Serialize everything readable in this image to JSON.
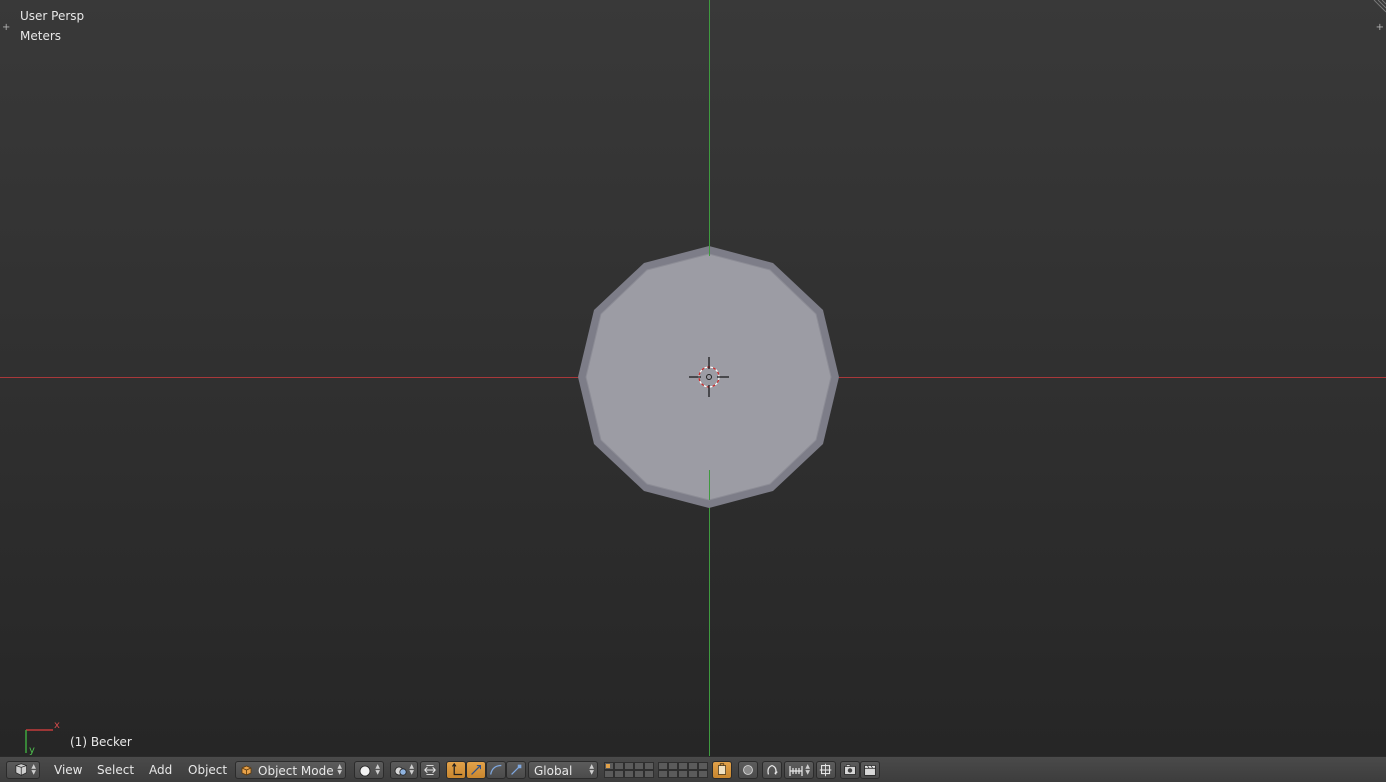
{
  "viewport": {
    "view_name": "User Persp",
    "units": "Meters",
    "object_info": "(1) Becker",
    "axis_x_label": "x",
    "axis_y_label": "y",
    "corner_plus": "+",
    "colors": {
      "x_axis": "#a8383a",
      "y_axis": "#3f9a3f",
      "mesh_face": "#9b9ba3",
      "mesh_edge": "#777781"
    }
  },
  "header": {
    "editor_type_icon": "cube-icon",
    "menus": {
      "view": "View",
      "select": "Select",
      "add": "Add",
      "object": "Object"
    },
    "mode": {
      "label": "Object Mode",
      "icon": "object-cube-icon"
    },
    "shading_icon": "solid-sphere-icon",
    "pivot_icon": "pivot-icon",
    "manipulator_toggle_icon": "manipulator-icon",
    "manipulator_translate_icon": "translate-arrow-icon",
    "manipulator_rotate_icon": "rotate-arc-icon",
    "manipulator_scale_icon": "scale-icon",
    "orientation": "Global",
    "lock_layers_icon": "lock-layers-icon",
    "proportional_icon": "proportional-circle-icon",
    "snap_icon": "magnet-icon",
    "snap_element_icon": "snap-increment-icon",
    "snap_target_icon": "snap-target-icon",
    "render_icon": "camera-icon",
    "anim_render_icon": "clapper-icon",
    "accent": "#d4933a"
  }
}
